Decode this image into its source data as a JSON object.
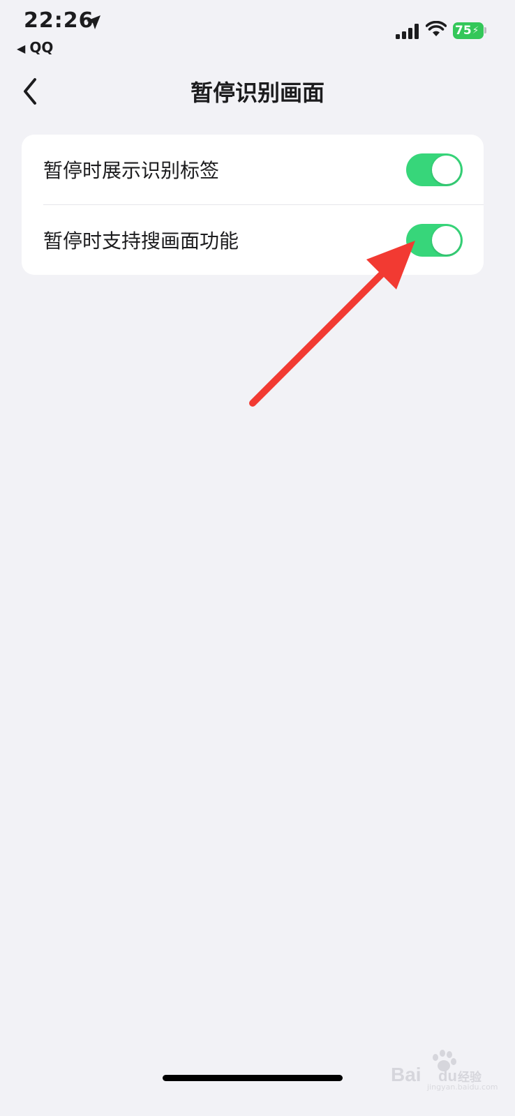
{
  "status_bar": {
    "time": "22:26",
    "back_app": "QQ",
    "battery_percent": "75",
    "battery_level": 0.75,
    "battery_color": "#34c759"
  },
  "nav": {
    "title": "暂停识别画面",
    "back_icon": "chevron-left-icon"
  },
  "settings": {
    "items": [
      {
        "label": "暂停时展示识别标签",
        "enabled": true
      },
      {
        "label": "暂停时支持搜画面功能",
        "enabled": true
      }
    ],
    "toggle_on_color": "#37d67a"
  },
  "annotation": {
    "arrow_color": "#f23a32",
    "target": "settings.items.1 toggle"
  },
  "watermark": {
    "brand": "Baidu经验",
    "url": "jingyan.baidu.com"
  }
}
